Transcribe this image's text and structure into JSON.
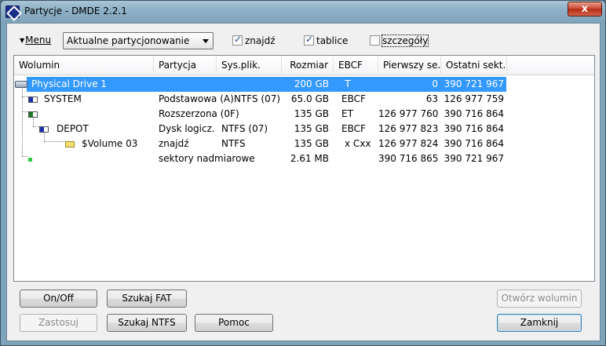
{
  "window": {
    "title": "Partycje - DMDE 2.2.1",
    "close_glyph": "x"
  },
  "toolbar": {
    "menu_label": "Menu",
    "partition_mode": "Aktualne partycjonowanie",
    "check_found": {
      "label": "znajdź",
      "checked": true
    },
    "check_tables": {
      "label": "tablice",
      "checked": true
    },
    "check_details": {
      "label": "szczegóły",
      "checked": false
    }
  },
  "table": {
    "columns": [
      "Wolumin",
      "Partycja",
      "Sys.plik.",
      "Rozmiar",
      "EBCF",
      "Pierwszy se...",
      "Ostatni sekt..."
    ],
    "rows": [
      {
        "name": "Physical Drive 1",
        "partition": "",
        "fs": "",
        "size": "200 GB",
        "ebcf": "T",
        "first": "0",
        "last": "390 721 967"
      },
      {
        "name": "SYSTEM",
        "partition": "Podstawowa (A)",
        "fs": "NTFS (07)",
        "size": "65.0 GB",
        "ebcf": "EBCF",
        "first": "63",
        "last": "126 977 759"
      },
      {
        "name": "",
        "partition": "Rozszerzona  (0F)",
        "fs": "",
        "size": "135 GB",
        "ebcf": "ET",
        "first": "126 977 760",
        "last": "390 716 864"
      },
      {
        "name": "DEPOT",
        "partition": "Dysk logicz.",
        "fs": "NTFS (07)",
        "size": "135 GB",
        "ebcf": "EBCF",
        "first": "126 977 823",
        "last": "390 716 864"
      },
      {
        "name": "$Volume 03",
        "partition": "znajdź",
        "fs": "NTFS",
        "size": "135 GB",
        "ebcf": "x Cxx",
        "first": "126 977 824",
        "last": "390 716 864"
      },
      {
        "name": "",
        "partition": "sektory nadmiarowe",
        "fs": "",
        "size": "2.61 MB",
        "ebcf": "",
        "first": "390 716 865",
        "last": "390 721 967"
      }
    ]
  },
  "buttons": {
    "onoff": "On/Off",
    "search_fat": "Szukaj FAT",
    "open_volume": "Otwórz wolumin",
    "apply": "Zastosuj",
    "search_ntfs": "Szukaj NTFS",
    "help": "Pomoc",
    "close": "Zamknij"
  }
}
